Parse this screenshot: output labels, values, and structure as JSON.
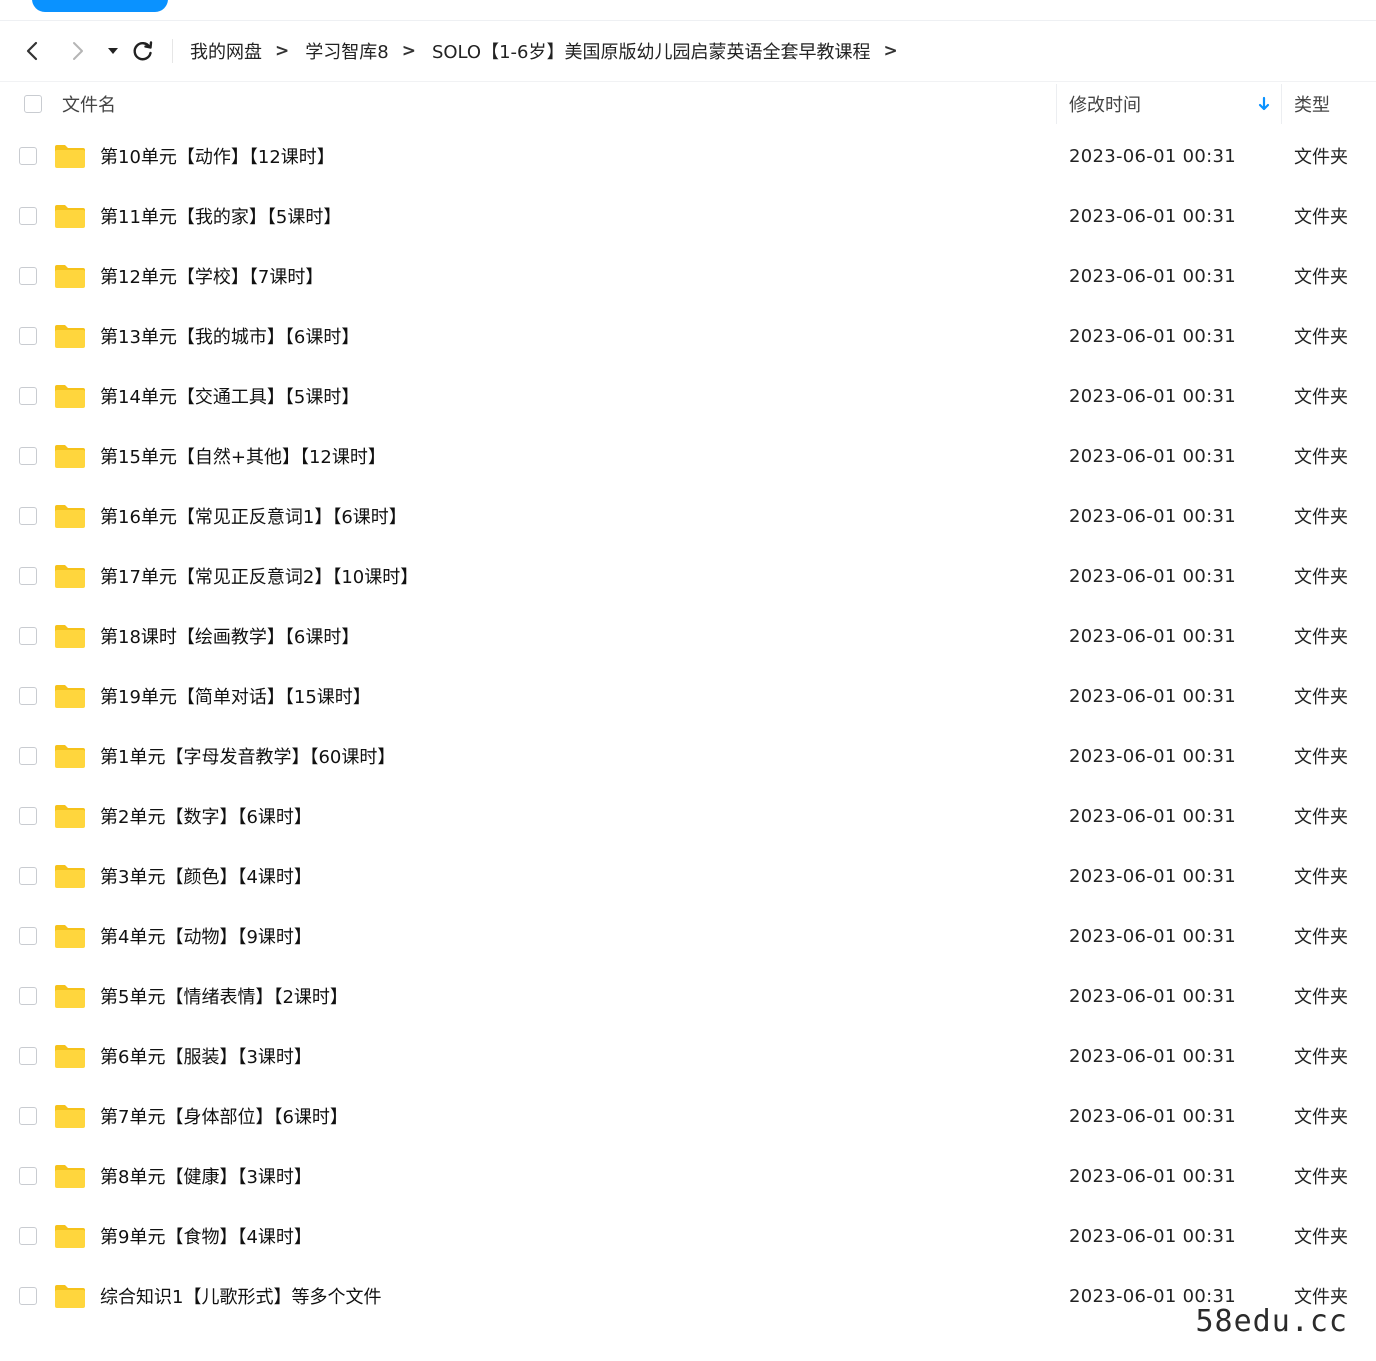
{
  "breadcrumb": {
    "items": [
      "我的网盘",
      "学习智库8",
      "SOLO【1-6岁】美国原版幼儿园启蒙英语全套早教课程"
    ],
    "separator": ">"
  },
  "nav_icons": {
    "back": "chevron-left-icon",
    "forward": "chevron-right-icon",
    "history": "caret-down-icon",
    "refresh": "refresh-icon"
  },
  "columns": {
    "name": "文件名",
    "modified": "修改时间",
    "type": "类型",
    "sort_icon": "arrow-down-icon"
  },
  "files": [
    {
      "name": "第10单元【动作】【12课时】",
      "modified": "2023-06-01 00:31",
      "type": "文件夹"
    },
    {
      "name": "第11单元【我的家】【5课时】",
      "modified": "2023-06-01 00:31",
      "type": "文件夹"
    },
    {
      "name": "第12单元【学校】【7课时】",
      "modified": "2023-06-01 00:31",
      "type": "文件夹"
    },
    {
      "name": "第13单元【我的城市】【6课时】",
      "modified": "2023-06-01 00:31",
      "type": "文件夹"
    },
    {
      "name": "第14单元【交通工具】【5课时】",
      "modified": "2023-06-01 00:31",
      "type": "文件夹"
    },
    {
      "name": "第15单元【自然+其他】【12课时】",
      "modified": "2023-06-01 00:31",
      "type": "文件夹"
    },
    {
      "name": "第16单元【常见正反意词1】【6课时】",
      "modified": "2023-06-01 00:31",
      "type": "文件夹"
    },
    {
      "name": "第17单元【常见正反意词2】【10课时】",
      "modified": "2023-06-01 00:31",
      "type": "文件夹"
    },
    {
      "name": "第18课时【绘画教学】【6课时】",
      "modified": "2023-06-01 00:31",
      "type": "文件夹"
    },
    {
      "name": "第19单元【简单对话】【15课时】",
      "modified": "2023-06-01 00:31",
      "type": "文件夹"
    },
    {
      "name": "第1单元【字母发音教学】【60课时】",
      "modified": "2023-06-01 00:31",
      "type": "文件夹"
    },
    {
      "name": "第2单元【数字】【6课时】",
      "modified": "2023-06-01 00:31",
      "type": "文件夹"
    },
    {
      "name": "第3单元【颜色】【4课时】",
      "modified": "2023-06-01 00:31",
      "type": "文件夹"
    },
    {
      "name": "第4单元【动物】【9课时】",
      "modified": "2023-06-01 00:31",
      "type": "文件夹"
    },
    {
      "name": "第5单元【情绪表情】【2课时】",
      "modified": "2023-06-01 00:31",
      "type": "文件夹"
    },
    {
      "name": "第6单元【服装】【3课时】",
      "modified": "2023-06-01 00:31",
      "type": "文件夹"
    },
    {
      "name": "第7单元【身体部位】【6课时】",
      "modified": "2023-06-01 00:31",
      "type": "文件夹"
    },
    {
      "name": "第8单元【健康】【3课时】",
      "modified": "2023-06-01 00:31",
      "type": "文件夹"
    },
    {
      "name": "第9单元【食物】【4课时】",
      "modified": "2023-06-01 00:31",
      "type": "文件夹"
    },
    {
      "name": "综合知识1【儿歌形式】等多个文件",
      "modified": "2023-06-01 00:31",
      "type": "文件夹"
    }
  ],
  "watermark": "58edu.cc",
  "colors": {
    "accent": "#0a92ff",
    "folder": "#ffd63d",
    "folder_tab": "#f5c21b"
  }
}
